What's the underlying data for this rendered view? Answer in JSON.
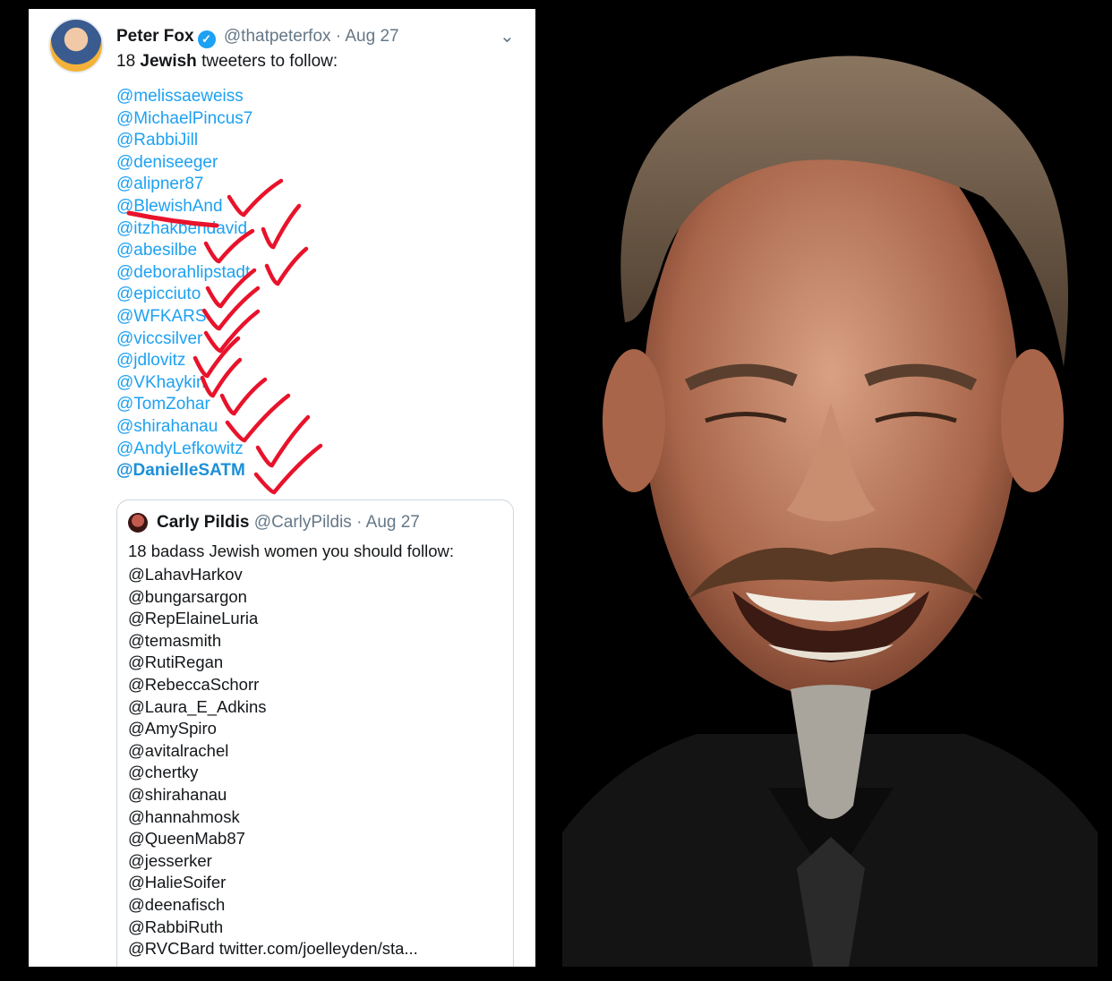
{
  "tweet": {
    "author_name": "Peter Fox",
    "author_handle": "@thatpeterfox",
    "date": "Aug 27",
    "separator": "·",
    "verified_glyph": "✓",
    "menu_glyph": "⌄",
    "text_prefix": "18 ",
    "text_bold": "Jewish",
    "text_suffix": " tweeters to follow:",
    "handles": [
      "@melissaeweiss",
      "@MichaelPincus7",
      "@RabbiJill",
      "@deniseeger",
      "@alipner87",
      "@BlewishAnd",
      "@itzhakbendavid",
      "@abesilbe",
      "@deborahlipstadt",
      "@epicciuto",
      "@WFKARS",
      "@viccsilver",
      "@jdlovitz",
      "@VKhaykin",
      "@TomZohar",
      "@shirahanau",
      "@AndyLefkowitz",
      "@DanielleSATM"
    ],
    "annotation_color": "#e8132b"
  },
  "quoted_tweet": {
    "author_name": "Carly Pildis",
    "author_handle": "@CarlyPildis",
    "date": "Aug 27",
    "separator": "·",
    "text": "18 badass Jewish women you should follow:",
    "handles": [
      "@LahavHarkov",
      "@bungarsargon",
      "@RepElaineLuria",
      "@temasmith",
      "@RutiRegan",
      "@RebeccaSchorr",
      "@Laura_E_Adkins",
      "@AmySpiro",
      "@avitalrachel",
      "@chertky",
      "@shirahanau",
      "@hannahmosk",
      "@QueenMab87",
      "@jesserker",
      "@HalieSoifer",
      "@deenafisch",
      "@RabbiRuth",
      "@RVCBard twitter.com/joelleyden/sta..."
    ]
  },
  "colors": {
    "link": "#1da1f2",
    "text": "#14171a",
    "muted": "#657786",
    "border": "#ccd6dd",
    "background": "#000000"
  }
}
